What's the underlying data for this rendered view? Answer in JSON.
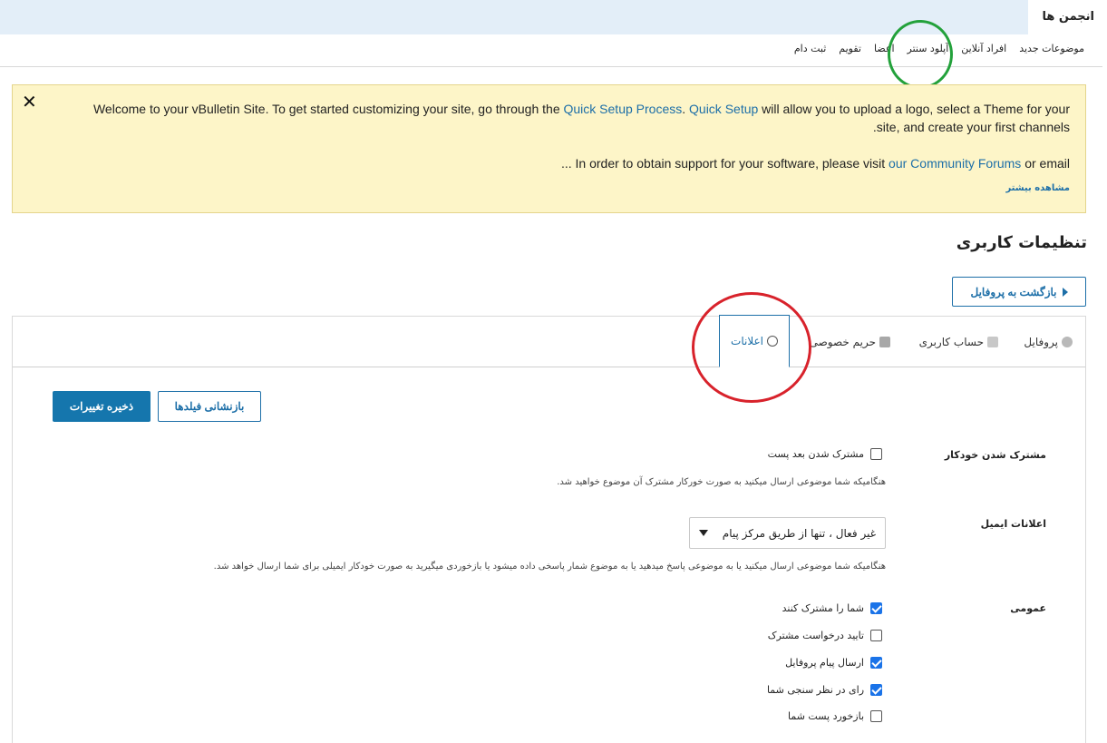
{
  "top_tab": {
    "label": "انجمن ها"
  },
  "nav": {
    "items": [
      "موضوعات جدید",
      "افراد آنلاین",
      "آپلود سنتر",
      "اعضا",
      "تقویم",
      "ثبت دام"
    ]
  },
  "notice": {
    "close_glyph": "✕",
    "line1_before": "Welcome to your vBulletin Site. To get started customizing your site, go through the ",
    "line1_link1": "Quick Setup Process",
    "line1_mid": ". ",
    "line1_link2": "Quick Setup",
    "line1_after": " will allow you to upload a logo, select a Theme for your",
    "line2": ".site, and create your first channels",
    "line3_before": "... In order to obtain support for your software, please visit ",
    "line3_link": "our Community Forums",
    "line3_after": " or email",
    "more": "مشاهده بیشتر"
  },
  "page": {
    "title": "تنظیمات کاربری",
    "back_button": "بازگشت به پروفایل"
  },
  "tabs": [
    {
      "label": "پروفایل",
      "icon": "user-icon"
    },
    {
      "label": "حساب کاربری",
      "icon": "id-card-icon"
    },
    {
      "label": "حریم خصوصی",
      "icon": "lock-icon"
    },
    {
      "label": "اعلانات",
      "icon": "speech-bubble-icon",
      "active": true
    }
  ],
  "form": {
    "save_button": "ذخیره تغییرات",
    "reset_button": "بازنشانی فیلدها",
    "auto_subscribe": {
      "label": "مشترک شدن خودکار",
      "option": "مشترک شدن بعد پست",
      "checked": false,
      "help": "هنگامیکه شما موضوعی ارسال میکنید به صورت خورکار مشترک آن موضوع خواهید شد."
    },
    "email_notify": {
      "label": "اعلانات ایمیل",
      "selected": "غیر فعال ، تنها از طریق مرکز پیام",
      "help": "هنگامیکه شما موضوعی ارسال میکنید یا به موضوعی پاسخ میدهید یا به موضوع شمار پاسخی داده میشود یا بازخوردی میگیرید به صورت خودکار ایمیلی برای شما ارسال خواهد شد."
    },
    "general": {
      "label": "عمومی",
      "options": [
        {
          "label": "شما را مشترک کنند",
          "checked": true
        },
        {
          "label": "تایید درخواست مشترک",
          "checked": false
        },
        {
          "label": "ارسال پیام پروفایل",
          "checked": true
        },
        {
          "label": "رای در نظر سنجی شما",
          "checked": true
        },
        {
          "label": "بازخورد پست شما",
          "checked": false
        }
      ]
    }
  },
  "colors": {
    "accent": "#1576ad",
    "notice_bg": "#fdf5c8",
    "annotation_green": "#23a13b",
    "annotation_red": "#d8222b"
  }
}
